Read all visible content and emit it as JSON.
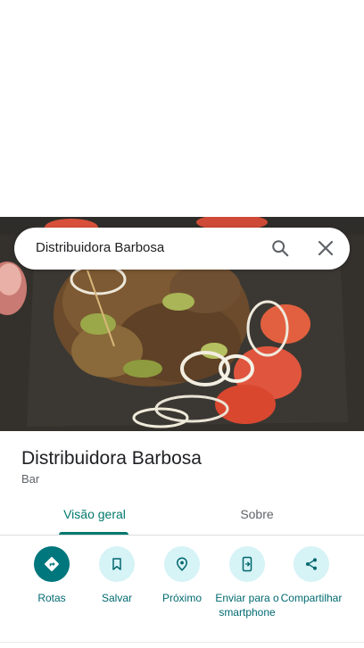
{
  "search": {
    "query": "Distribuidora Barbosa"
  },
  "place": {
    "title": "Distribuidora Barbosa",
    "category": "Bar",
    "photo_icon": "food-photo"
  },
  "tabs": [
    {
      "label": "Visão geral",
      "active": true
    },
    {
      "label": "Sobre",
      "active": false
    }
  ],
  "actions": [
    {
      "label": "Rotas",
      "icon": "directions-icon"
    },
    {
      "label": "Salvar",
      "icon": "bookmark-icon"
    },
    {
      "label": "Próximo",
      "icon": "nearby-icon"
    },
    {
      "label": "Enviar para o smartphone",
      "icon": "send-to-phone-icon"
    },
    {
      "label": "Compartilhar",
      "icon": "share-icon"
    }
  ],
  "colors": {
    "accent": "#00796b",
    "action_bg": "#d6f3f6",
    "primary_action": "#00767d"
  }
}
